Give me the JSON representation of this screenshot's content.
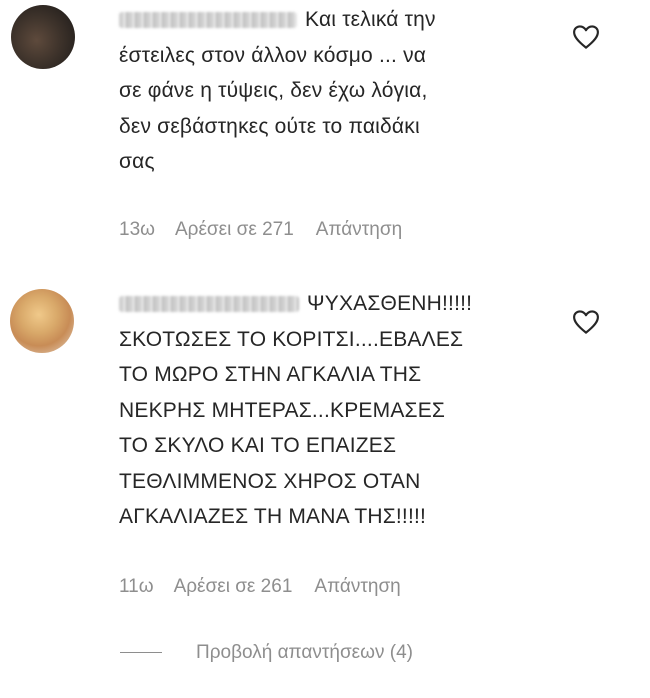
{
  "comments": [
    {
      "text_lines": [
        "Και τελικά την",
        "έστειλες στον άλλον κόσμο ... να",
        "σε φάνε η τύψεις, δεν έχω λόγια,",
        "δεν σεβάστηκες ούτε το παιδάκι",
        "σας"
      ],
      "time": "13ω",
      "likes": "Αρέσει σε 271",
      "reply": "Απάντηση"
    },
    {
      "text_lines": [
        "ΨΥΧΑΣΘΕΝΗ!!!!!",
        "ΣΚΟΤΩΣΕΣ ΤΟ ΚΟΡΙΤΣΙ....ΕΒΑΛΕΣ",
        "ΤΟ ΜΩΡΟ ΣΤΗΝ ΑΓΚΑΛΙΑ ΤΗΣ",
        "ΝΕΚΡΗΣ ΜΗΤΕΡΑΣ...ΚΡΕΜΑΣΕΣ",
        "ΤΟ ΣΚΥΛΟ ΚΑΙ ΤΟ ΕΠΑΙΖΕΣ",
        "ΤΕΘΛΙΜΜΕΝΟΣ ΧΗΡΟΣ ΟΤΑΝ",
        "ΑΓΚΑΛΙΑΖΕΣ ΤΗ ΜΑΝΑ ΤΗΣ!!!!!"
      ],
      "time": "11ω",
      "likes": "Αρέσει σε 261",
      "reply": "Απάντηση"
    }
  ],
  "view_replies": "Προβολή απαντήσεων (4)",
  "icons": {
    "like": "heart-icon"
  },
  "colors": {
    "text": "#262626",
    "secondary": "#8e8e8e"
  }
}
